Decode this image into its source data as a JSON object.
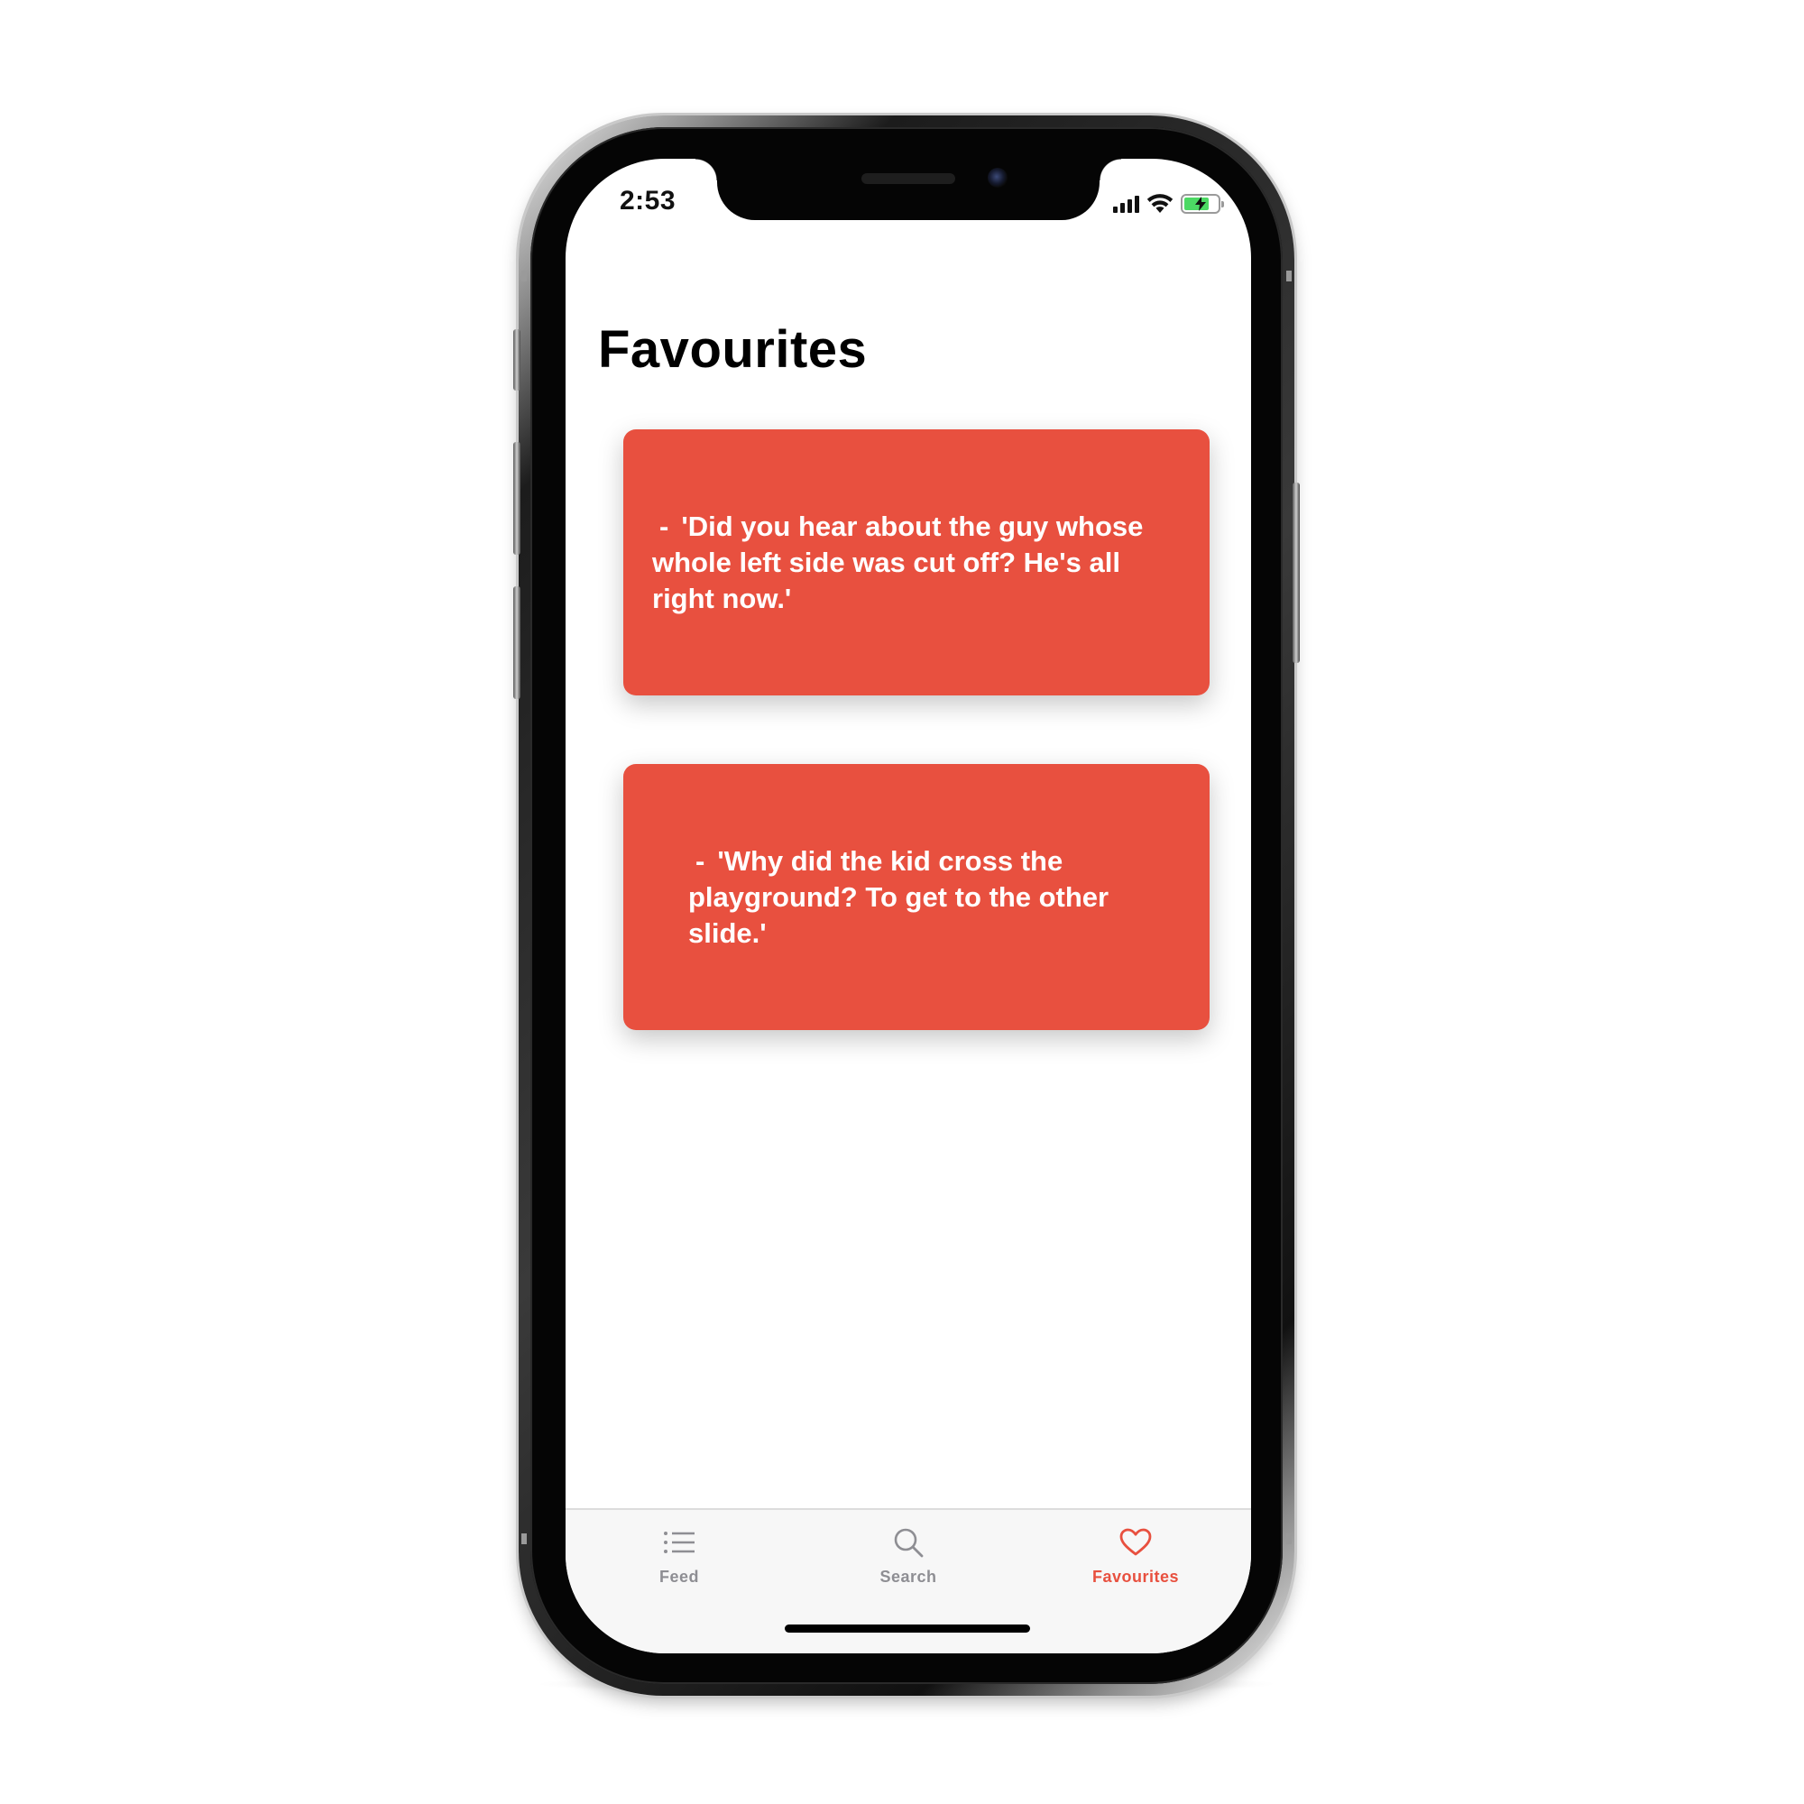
{
  "status_bar": {
    "time": "2:53",
    "icons": [
      "signal-icon",
      "wifi-icon",
      "battery-charging-icon"
    ],
    "battery_level": 0.74,
    "battery_color": "#4cd964"
  },
  "page": {
    "title": "Favourites"
  },
  "favourites": [
    {
      "bullet": "-",
      "text": "'Did you hear about the guy whose whole left side was cut off? He's all right now.'"
    },
    {
      "bullet": "-",
      "text": "'Why did the kid cross the playground? To get to the other slide.'"
    }
  ],
  "colors": {
    "accent": "#e8503f",
    "card_background": "#e8503f",
    "inactive_tab": "#8e8e93",
    "tab_bar_background": "#f7f7f7"
  },
  "tab_bar": {
    "tabs": [
      {
        "label": "Feed",
        "icon": "list-icon",
        "active": false
      },
      {
        "label": "Search",
        "icon": "search-icon",
        "active": false
      },
      {
        "label": "Favourites",
        "icon": "heart-icon",
        "active": true
      }
    ]
  }
}
